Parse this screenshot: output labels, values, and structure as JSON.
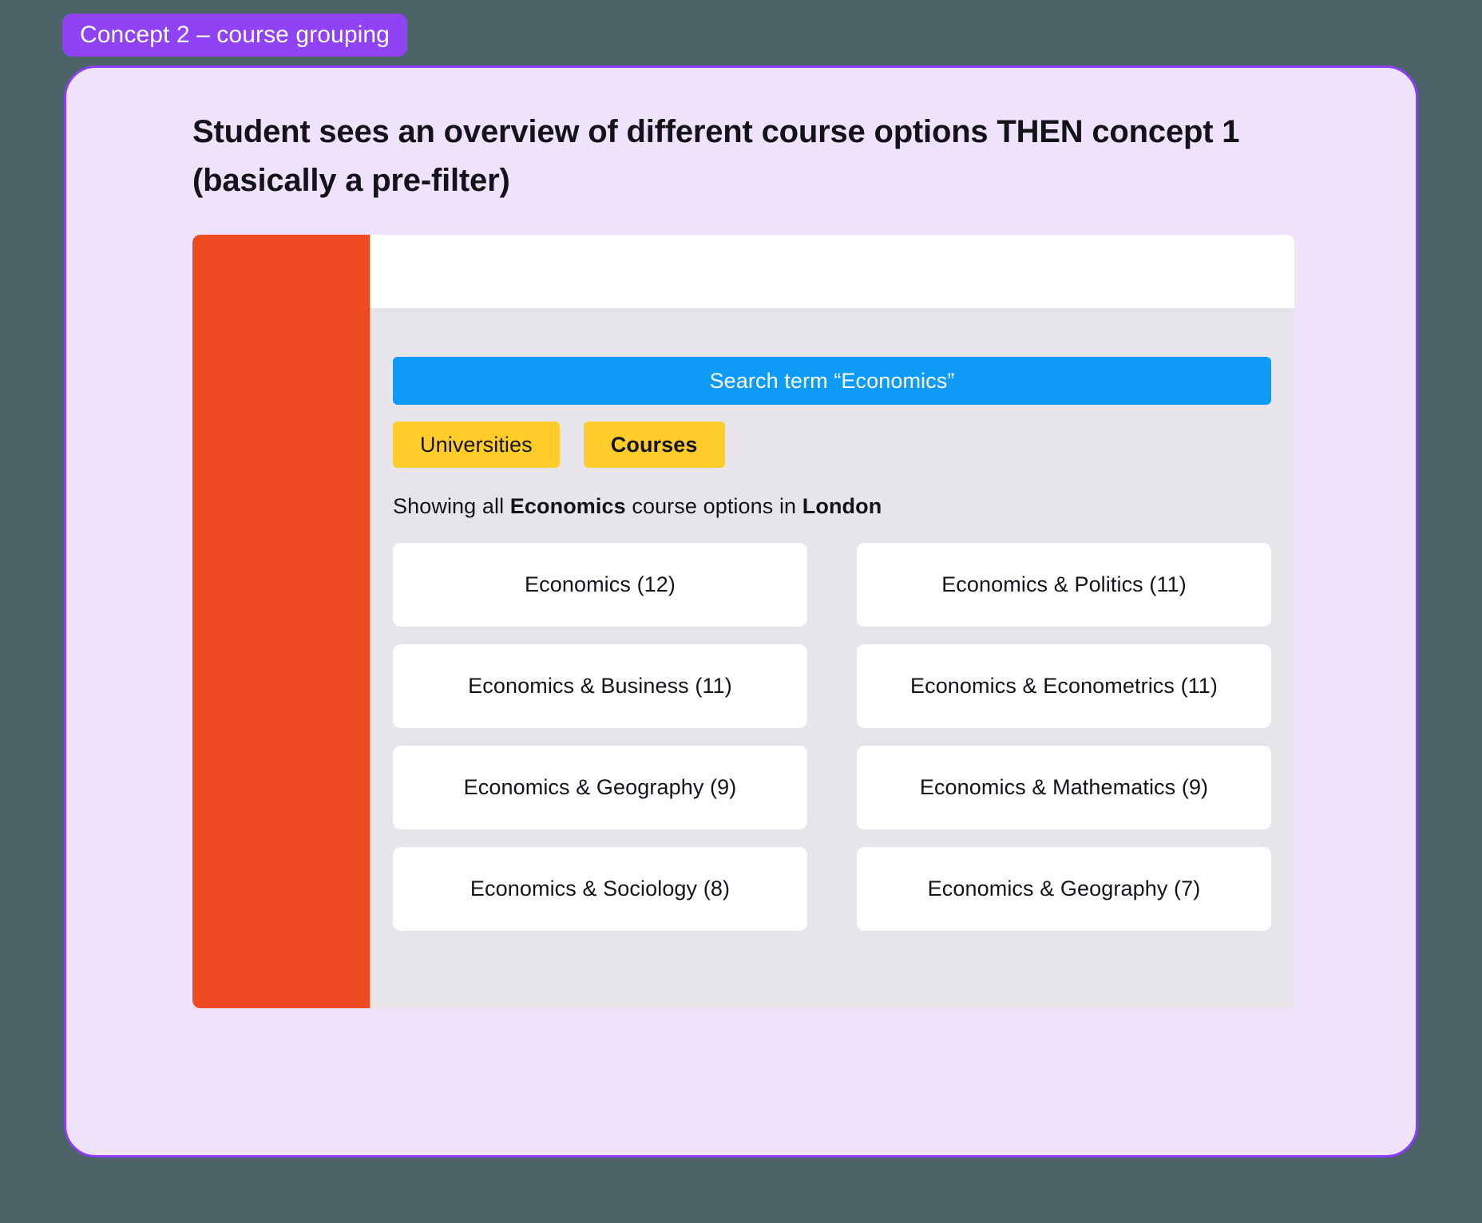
{
  "badge": {
    "label": "Concept 2 – course grouping"
  },
  "panel": {
    "heading": "Student sees an overview of different course options THEN concept 1 (basically a pre-filter)"
  },
  "mockup": {
    "search_bar": {
      "label": "Search term “Economics”"
    },
    "tabs": [
      {
        "label": "Universities",
        "active": false
      },
      {
        "label": "Courses",
        "active": true
      }
    ],
    "status": {
      "prefix": "Showing all ",
      "subject": "Economics",
      "middle": " course options in ",
      "location": "London"
    },
    "courses": [
      {
        "label": "Economics (12)"
      },
      {
        "label": "Economics & Politics (11)"
      },
      {
        "label": "Economics & Business (11)"
      },
      {
        "label": "Economics & Econometrics (11)"
      },
      {
        "label": "Economics & Geography (9)"
      },
      {
        "label": "Economics & Mathematics (9)"
      },
      {
        "label": "Economics & Sociology (8)"
      },
      {
        "label": "Economics & Geography (7)"
      }
    ]
  },
  "colors": {
    "page_background": "#4C6468",
    "badge": "#9042F5",
    "panel_background": "#EFE2FB",
    "panel_border": "#8C3CFB",
    "sidebar": "#F04A23",
    "topbar": "#FFFFFF",
    "content_background": "#E7E5EA",
    "search_bar": "#0D9BF5",
    "tab": "#FFCC29",
    "card": "#FFFFFF",
    "text": "#13131A"
  }
}
